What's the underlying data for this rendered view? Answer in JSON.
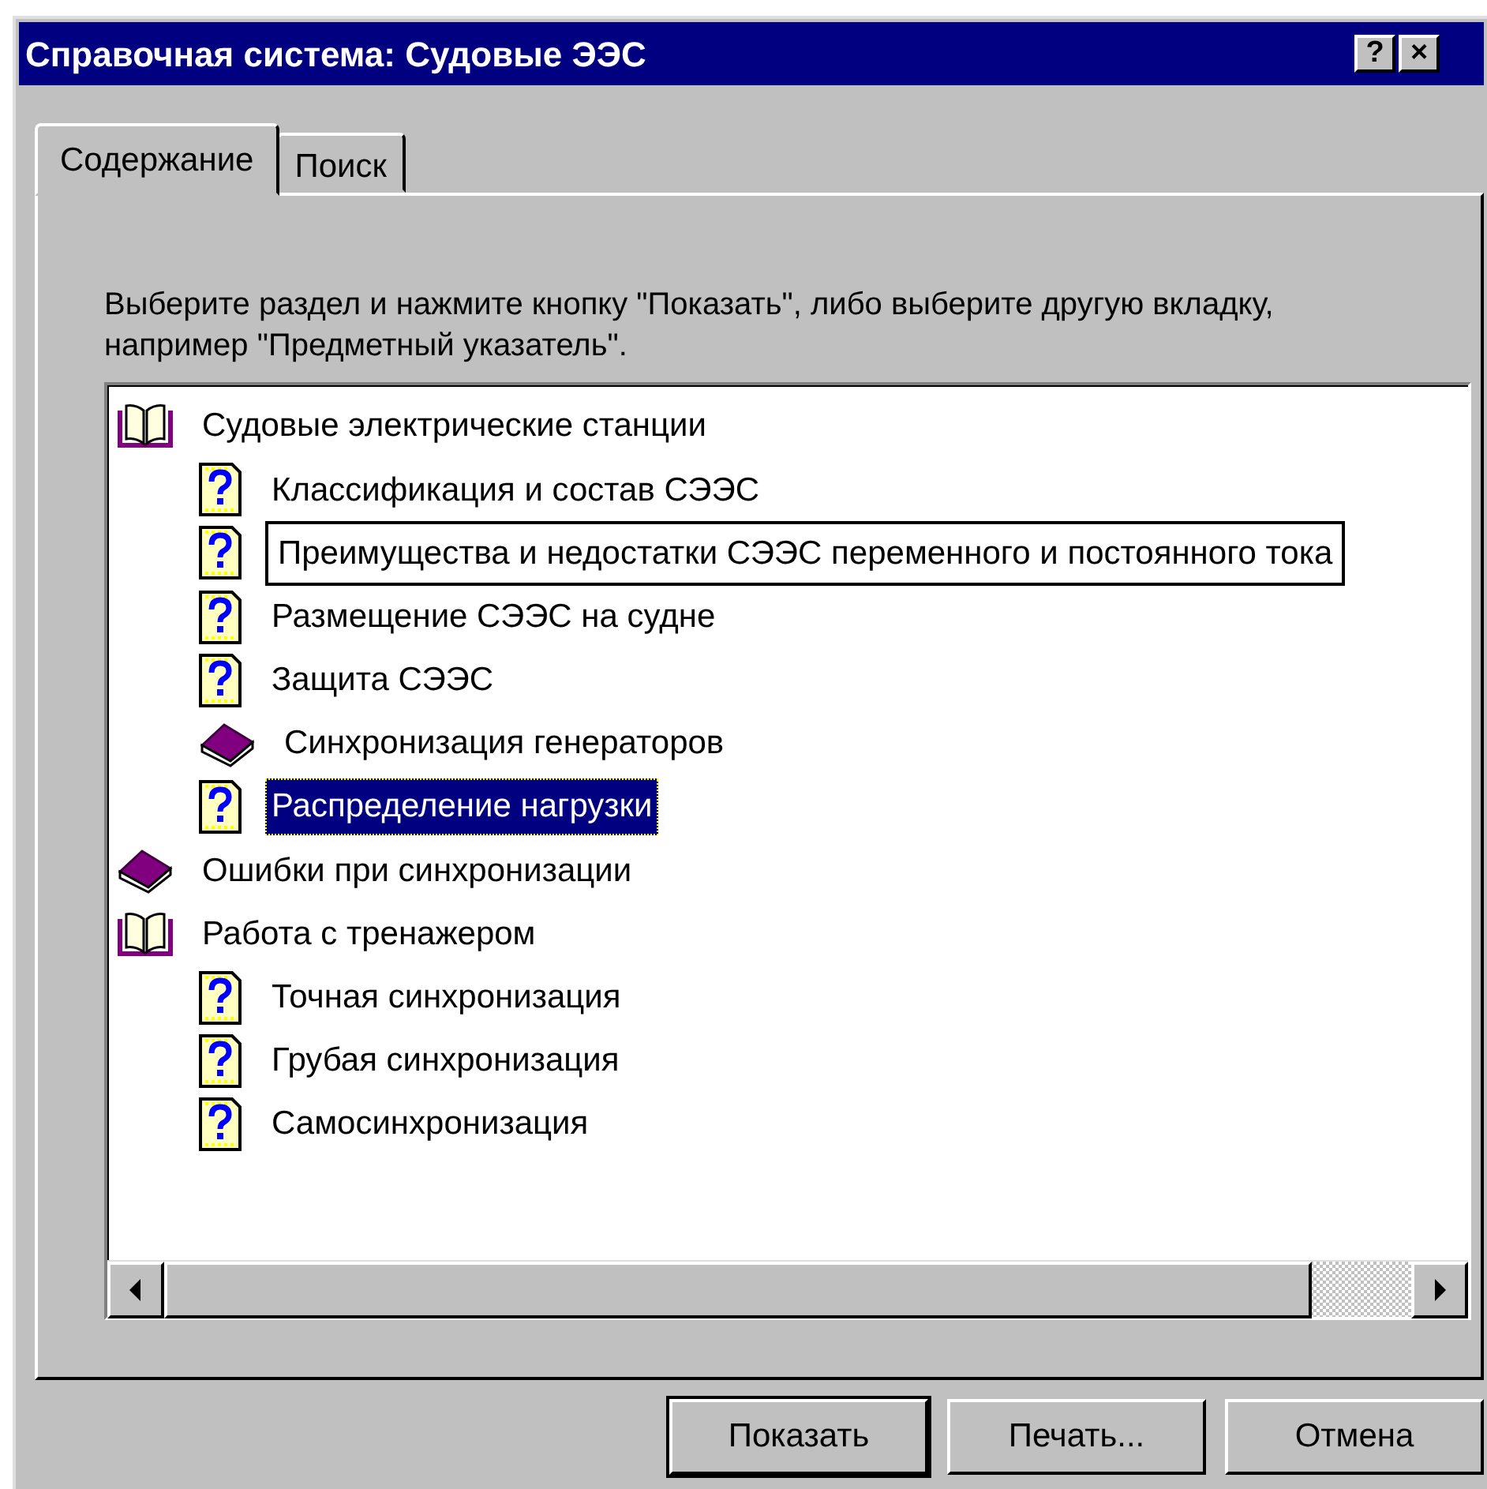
{
  "window": {
    "title": "Справочная система: Судовые ЭЭС",
    "title_buttons": [
      "?",
      "×"
    ]
  },
  "tabs": [
    {
      "label": "Содержание",
      "selected": true
    },
    {
      "label": "Поиск",
      "selected": false
    }
  ],
  "instructions": "Выберите раздел и нажмите кнопку \"Показать\", либо выберите другую вкладку, например \"Предметный указатель\".",
  "tree": [
    {
      "kind": "book",
      "expanded": true,
      "label": "Судовые электрические станции",
      "selected": false,
      "hovered": false,
      "children": [
        {
          "kind": "topic",
          "label": "Классификация и состав СЭЭС",
          "selected": false,
          "hovered": false
        },
        {
          "kind": "topic",
          "label": "Преимущества и недостатки СЭЭС переменного и постоянного тока",
          "selected": false,
          "hovered": true
        },
        {
          "kind": "topic",
          "label": "Размещение СЭЭС на судне",
          "selected": false,
          "hovered": false
        },
        {
          "kind": "topic",
          "label": "Защита СЭЭС",
          "selected": false,
          "hovered": false
        },
        {
          "kind": "book",
          "expanded": false,
          "label": "Синхронизация генераторов",
          "selected": false,
          "hovered": false
        },
        {
          "kind": "topic",
          "label": "Распределение нагрузки",
          "selected": true,
          "hovered": false
        }
      ]
    },
    {
      "kind": "book",
      "expanded": false,
      "label": "Ошибки при синхронизации",
      "selected": false,
      "hovered": false
    },
    {
      "kind": "book",
      "expanded": true,
      "label": "Работа с тренажером",
      "selected": false,
      "hovered": false,
      "children": [
        {
          "kind": "topic",
          "label": "Точная синхронизация",
          "selected": false,
          "hovered": false
        },
        {
          "kind": "topic",
          "label": "Грубая синхронизация",
          "selected": false,
          "hovered": false
        },
        {
          "kind": "topic",
          "label": "Самосинхронизация",
          "selected": false,
          "hovered": false
        }
      ]
    }
  ],
  "buttons": [
    {
      "label": "Показать",
      "default": true
    },
    {
      "label": "Печать...",
      "default": false
    },
    {
      "label": "Отмена",
      "default": false
    }
  ]
}
